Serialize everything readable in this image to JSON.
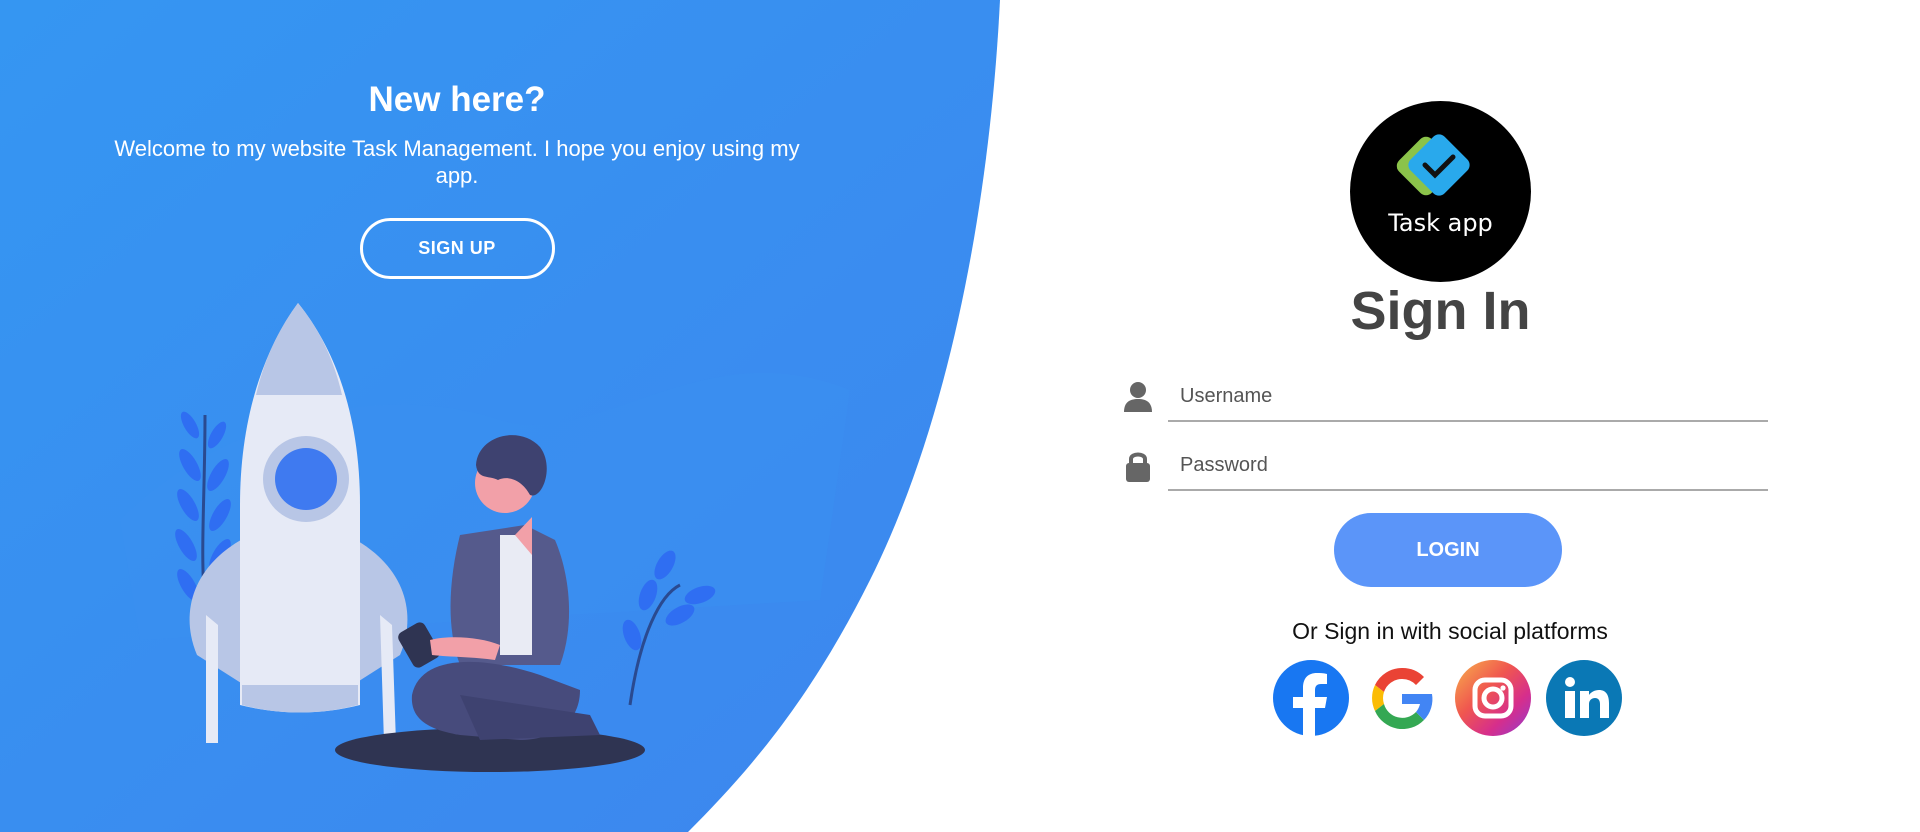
{
  "left_panel": {
    "title": "New here?",
    "description": "Welcome to my website Task Management. I hope you enjoy using my app.",
    "signup_label": "SIGN UP"
  },
  "logo": {
    "text": "Task app"
  },
  "form": {
    "title": "Sign In",
    "username_placeholder": "Username",
    "password_placeholder": "Password",
    "login_label": "LOGIN",
    "social_text": "Or Sign in with social platforms"
  },
  "social_icons": [
    "facebook-icon",
    "google-icon",
    "instagram-icon",
    "linkedin-icon"
  ],
  "colors": {
    "panel_blue": "#3a93f0",
    "login_button": "#5b95f9",
    "title_gray": "#444444"
  }
}
